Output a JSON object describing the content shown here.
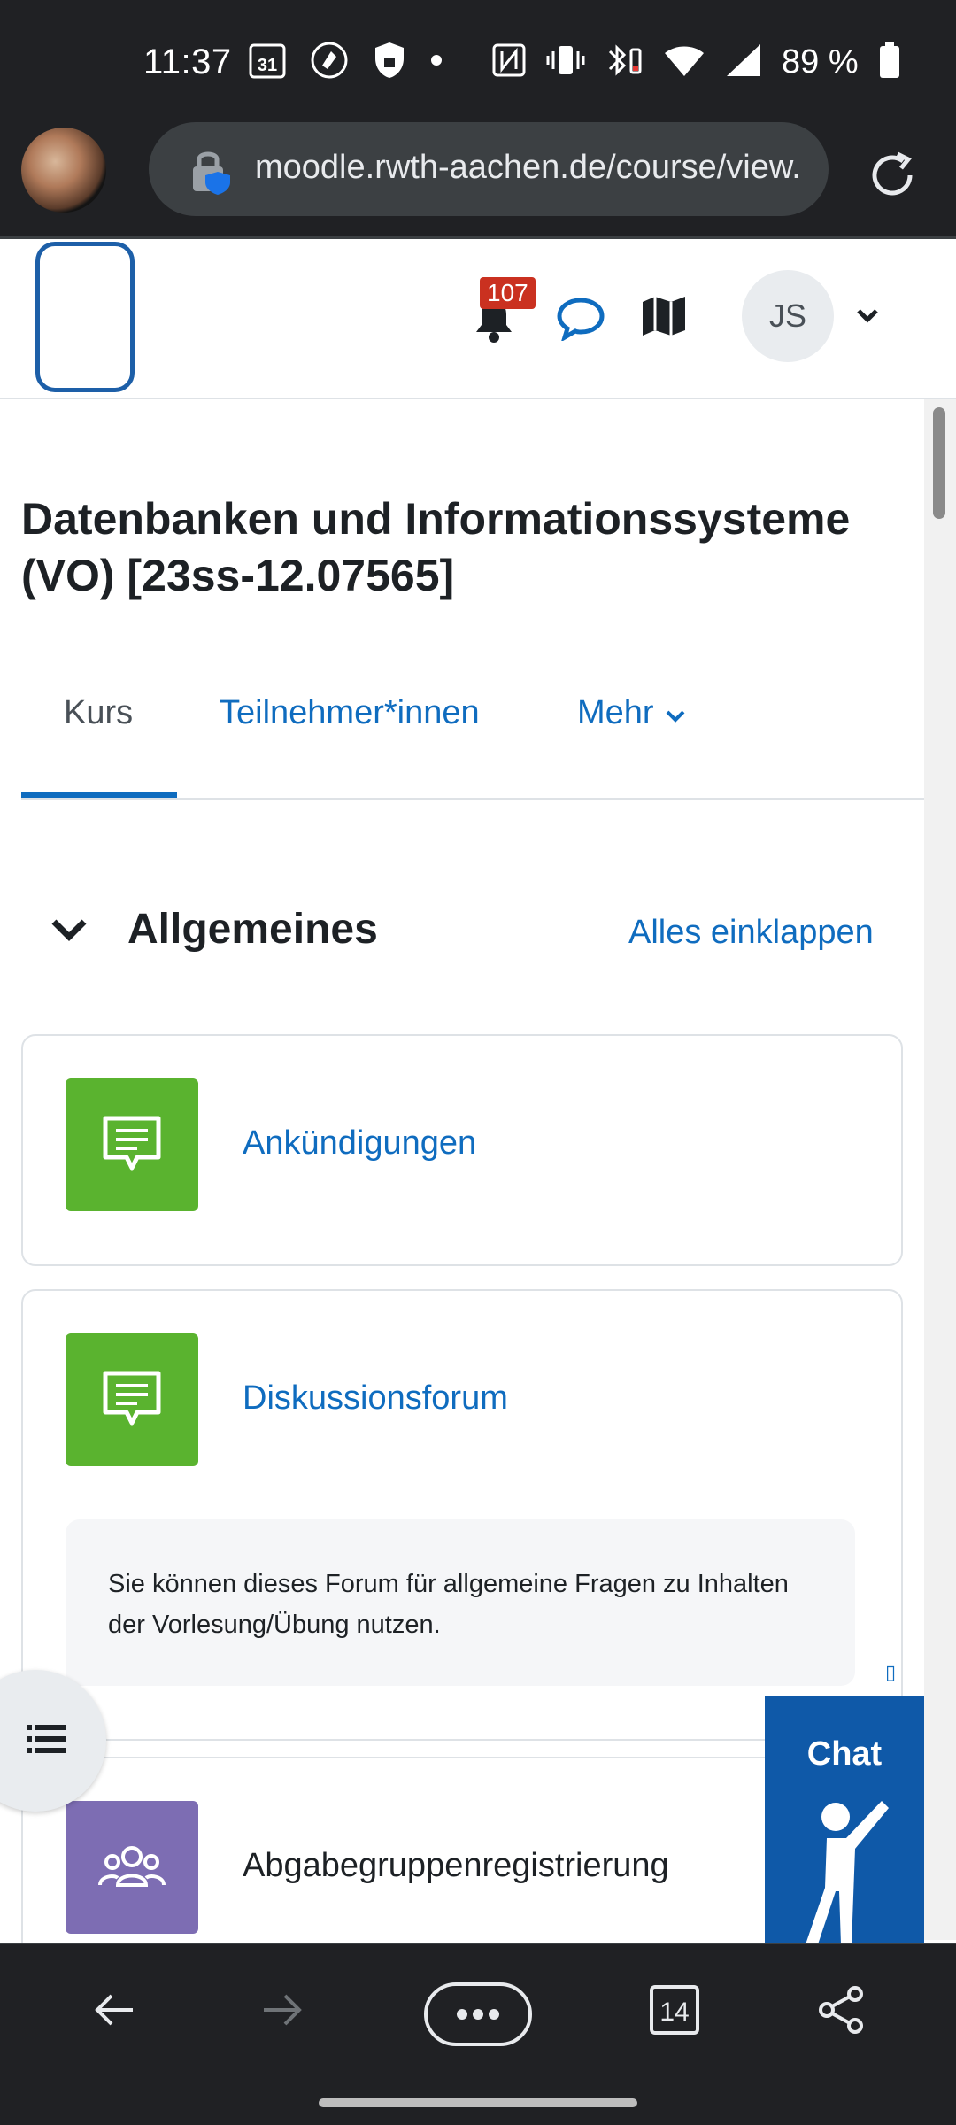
{
  "status_bar": {
    "time": "11:37",
    "calendar_day": "31",
    "battery_percent": "89 %"
  },
  "browser": {
    "url": "moodle.rwth-aachen.de/course/view.",
    "tab_count": "14"
  },
  "header": {
    "notification_count": "107",
    "user_initials": "JS"
  },
  "course": {
    "title": "Datenbanken und Informationssysteme (VO) [23ss-12.07565]"
  },
  "tabs": {
    "course": "Kurs",
    "participants": "Teilnehmer*innen",
    "more": "Mehr"
  },
  "section": {
    "title": "Allgemeines",
    "collapse_all": "Alles einklappen"
  },
  "activities": [
    {
      "name": "Ankündigungen",
      "icon": "forum-icon",
      "color": "#5ab32f"
    },
    {
      "name": "Diskussionsforum",
      "icon": "forum-icon",
      "color": "#5ab32f",
      "description": "Sie können dieses Forum für allgemeine Fragen zu Inhalten der Vorlesung/Übung nutzen."
    },
    {
      "name": "Abgabegruppenregistrierung",
      "icon": "group-icon",
      "color": "#7d6db3"
    }
  ],
  "chat": {
    "label": "Chat"
  },
  "colors": {
    "accent": "#0f6cbf",
    "badge": "#ca3120",
    "system_bar": "#202124"
  }
}
